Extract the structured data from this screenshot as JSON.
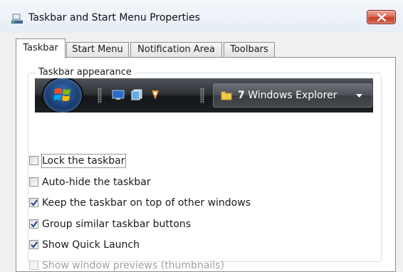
{
  "window": {
    "title": "Taskbar and Start Menu Properties",
    "icon": "taskbar-properties-icon",
    "close_icon": "close-icon"
  },
  "tabs": [
    {
      "label": "Taskbar",
      "active": true
    },
    {
      "label": "Start Menu",
      "active": false
    },
    {
      "label": "Notification Area",
      "active": false
    },
    {
      "label": "Toolbars",
      "active": false
    }
  ],
  "group": {
    "label": "Taskbar appearance"
  },
  "taskbar_preview": {
    "start_orb_icon": "windows-start-orb-icon",
    "quick_launch_icons": [
      "show-desktop-icon",
      "window-switcher-icon",
      "media-player-icon"
    ],
    "button_count": "7",
    "button_label": "Windows Explorer",
    "button_icon": "folder-icon"
  },
  "options": [
    {
      "label": "Lock the taskbar",
      "checked": false,
      "enabled": true,
      "focused": true
    },
    {
      "label": "Auto-hide the taskbar",
      "checked": false,
      "enabled": true
    },
    {
      "label": "Keep the taskbar on top of other windows",
      "checked": true,
      "enabled": true
    },
    {
      "label": "Group similar taskbar buttons",
      "checked": true,
      "enabled": true
    },
    {
      "label": "Show Quick Launch",
      "checked": true,
      "enabled": true
    },
    {
      "label": "Show window previews (thumbnails)",
      "checked": false,
      "enabled": false
    }
  ],
  "colors": {
    "close_button": "#d35a44",
    "taskbar": "#2e3135",
    "checkmark": "#1f3f84"
  }
}
